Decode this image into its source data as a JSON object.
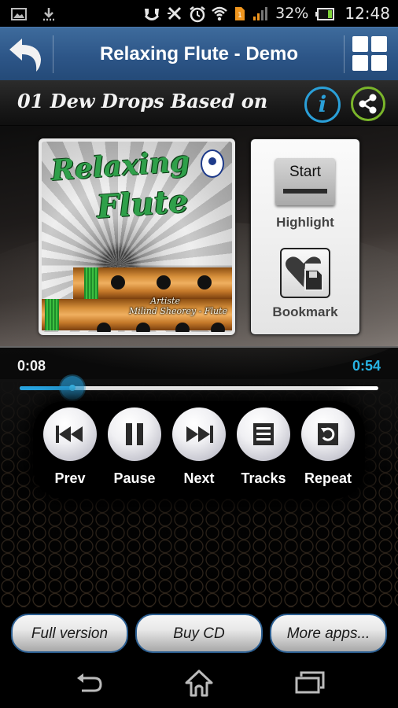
{
  "status_bar": {
    "left_icons": [
      "gallery-icon",
      "download-icon"
    ],
    "right_icons": [
      "headset-icon",
      "bluetooth-off-icon",
      "alarm-icon",
      "wifi-icon",
      "sim-icon",
      "signal-icon"
    ],
    "sim_label": "1",
    "battery_percent": "32%",
    "battery_level": 0.32,
    "time": "12:48"
  },
  "action_bar": {
    "title": "Relaxing Flute - Demo",
    "back_icon": "back-arrow-icon",
    "menu_icon": "grid-icon"
  },
  "track": {
    "title": "01 Dew Drops Based on",
    "info_label": "i"
  },
  "album": {
    "title_line1": "Relaxing",
    "title_line2": "Flute",
    "artist_label": "Artiste",
    "artist_name": "Milind Sheorey - Flute"
  },
  "side_panel": {
    "highlight_button_label": "Start",
    "highlight_label": "Highlight",
    "bookmark_label": "Bookmark"
  },
  "progress": {
    "current_time": "0:08",
    "total_time": "0:54",
    "fraction": 0.148
  },
  "controls": [
    {
      "id": "prev",
      "label": "Prev",
      "icon": "skip-previous-icon"
    },
    {
      "id": "pause",
      "label": "Pause",
      "icon": "pause-icon"
    },
    {
      "id": "next",
      "label": "Next",
      "icon": "skip-next-icon"
    },
    {
      "id": "tracks",
      "label": "Tracks",
      "icon": "list-icon"
    },
    {
      "id": "repeat",
      "label": "Repeat",
      "icon": "repeat-icon"
    }
  ],
  "bottom_buttons": [
    {
      "id": "full-version",
      "label": "Full version"
    },
    {
      "id": "buy-cd",
      "label": "Buy CD"
    },
    {
      "id": "more-apps",
      "label": "More apps..."
    }
  ],
  "colors": {
    "action_bar": "#2d5688",
    "accent_blue": "#27a2de",
    "total_time": "#27b3e3",
    "info_ring": "#2a9fd8",
    "share_ring": "#7ab52a"
  }
}
